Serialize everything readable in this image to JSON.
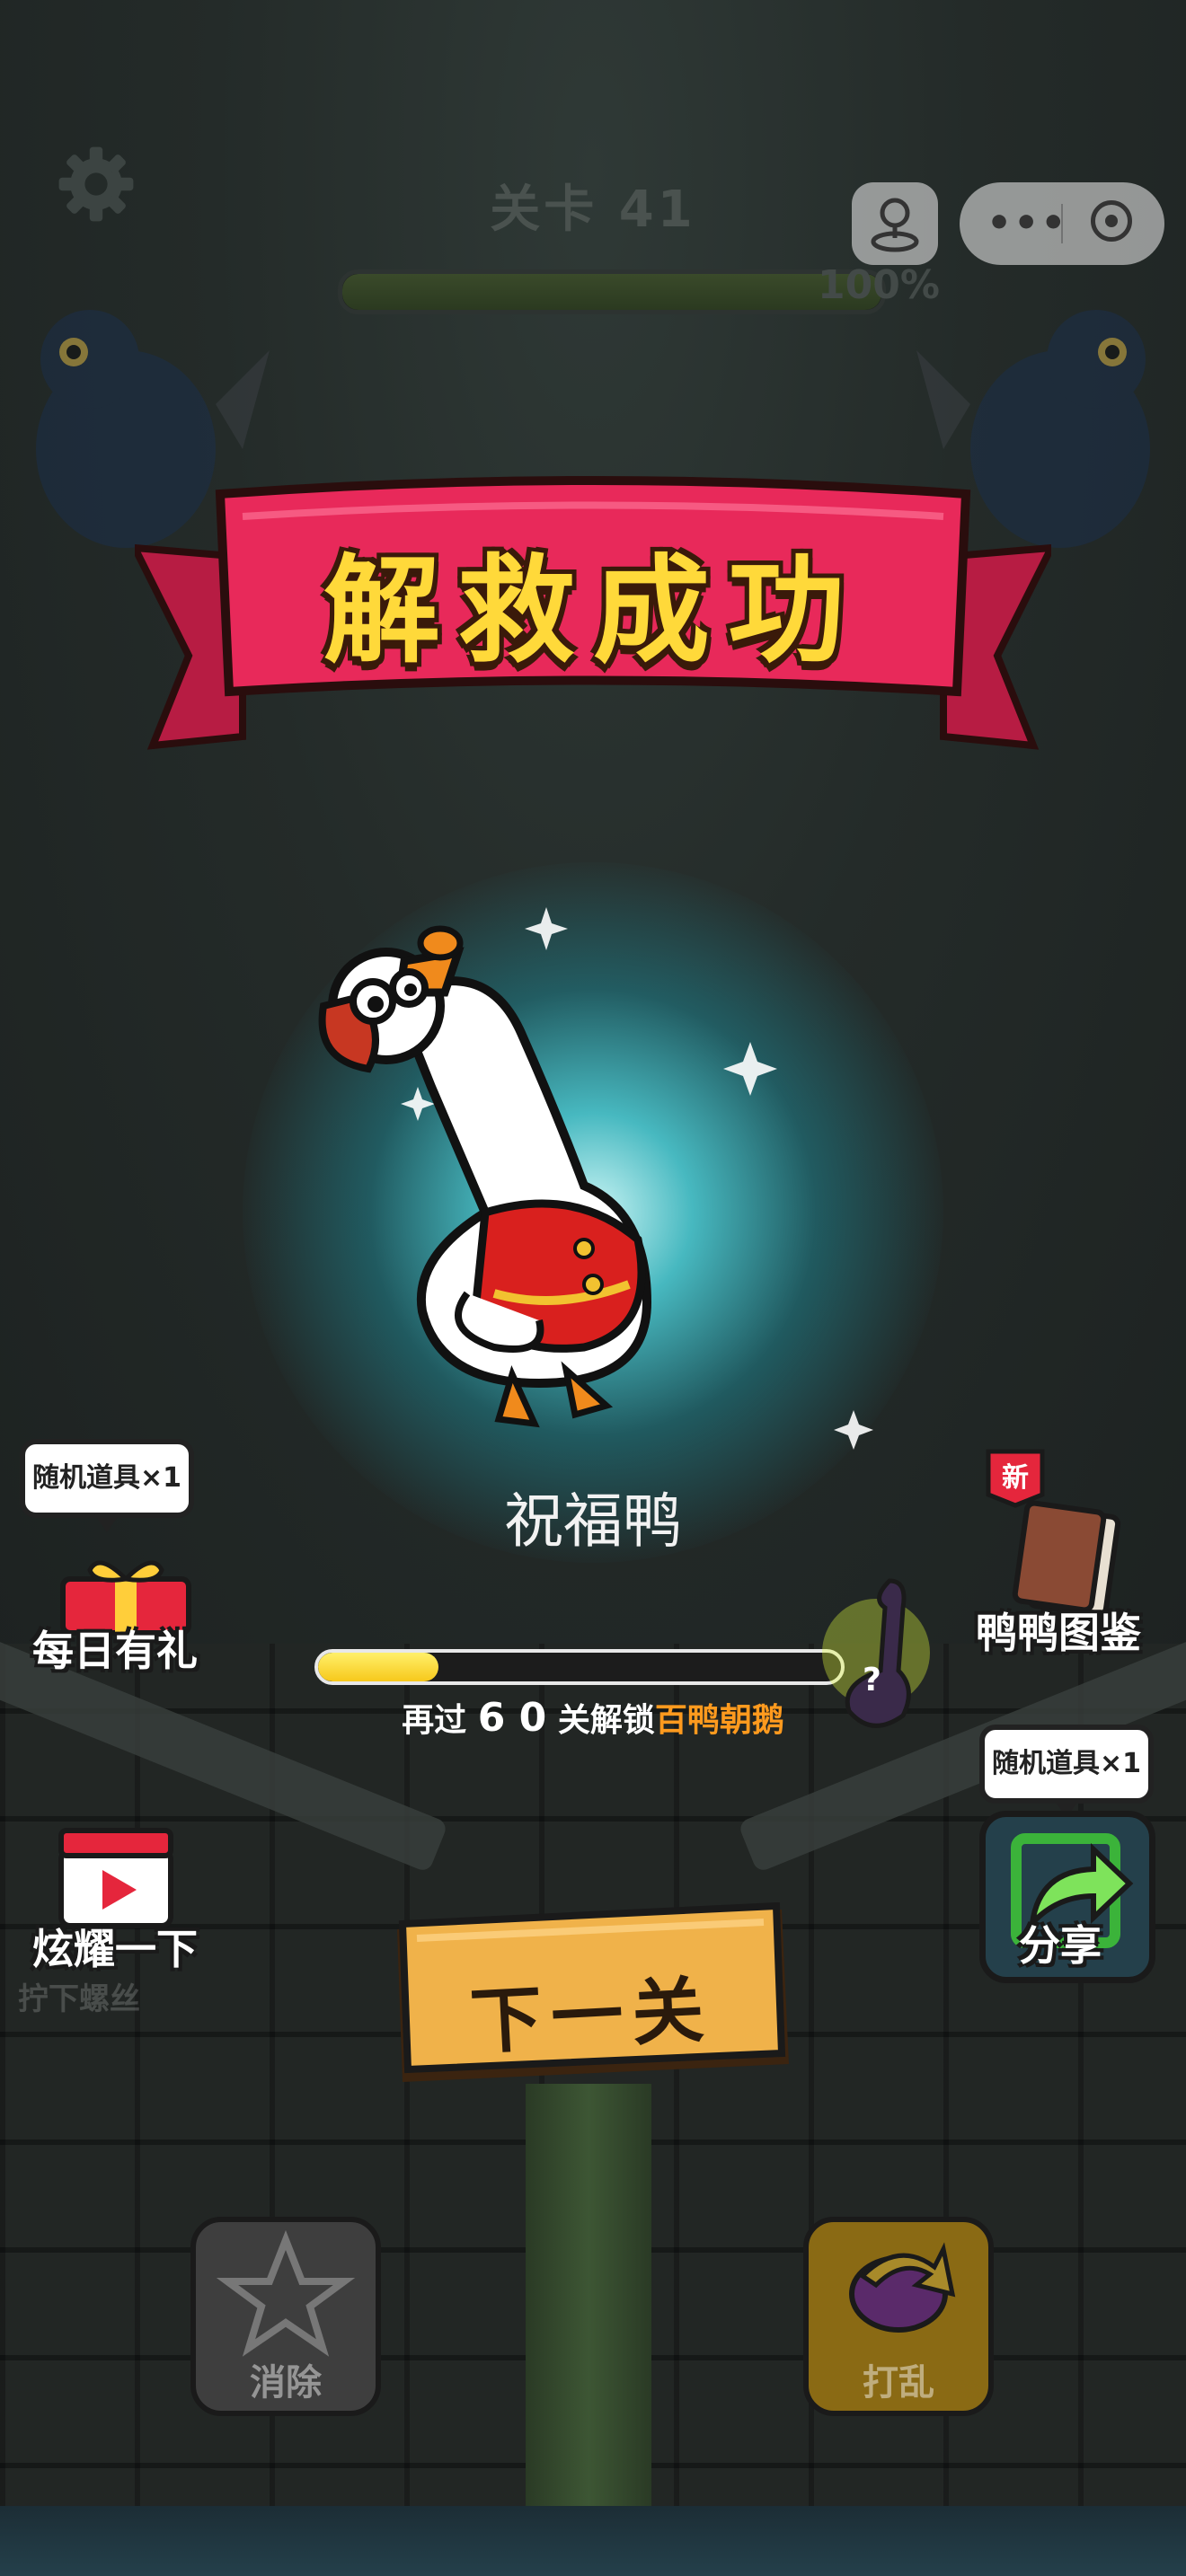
{
  "header": {
    "level_label": "关卡 41",
    "progress_text": "100%",
    "progress_value": 1.0
  },
  "banner": {
    "title": "解救成功"
  },
  "reward": {
    "duck_name": "祝福鸭"
  },
  "left_widgets": {
    "gift_bubble": "随机道具×1",
    "daily_gift_label": "每日有礼",
    "show_off_label": "炫耀一下",
    "faded_label": "拧下螺丝"
  },
  "right_widgets": {
    "new_badge": "新",
    "encyclopedia_label": "鸭鸭图鉴",
    "share_bubble": "随机道具×1",
    "share_label": "分享",
    "mystery_mark": "?"
  },
  "unlock": {
    "progress_value": 0.23,
    "prefix": "再过",
    "count": "6 0",
    "middle": "关解锁",
    "target": "百鸭朝鹅"
  },
  "next_button": {
    "label": "下一关"
  },
  "tools": {
    "remove_label": "消除",
    "shuffle_label": "打乱"
  },
  "colors": {
    "banner_red": "#e8295a",
    "banner_text": "#ffd93a",
    "highlight_orange": "#ff9a1e",
    "progress_yellow": "#f7c81b",
    "button_wood": "#f0b24a"
  }
}
